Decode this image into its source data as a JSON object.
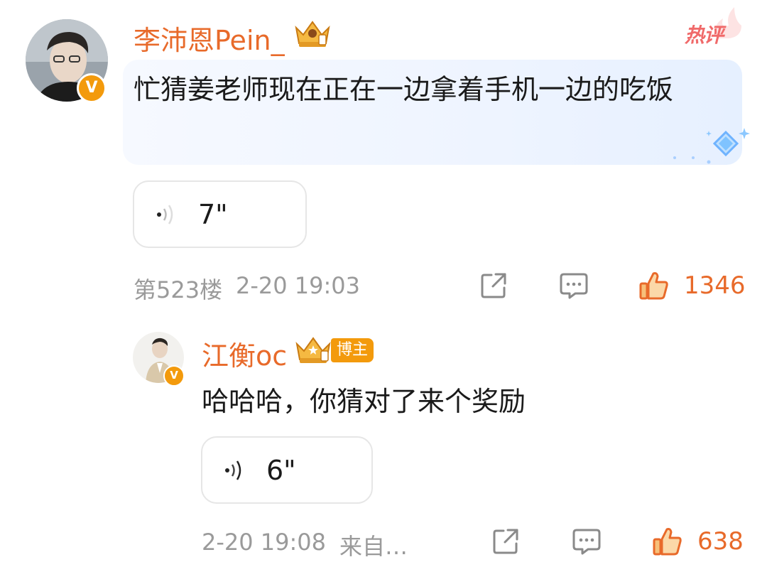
{
  "comment": {
    "username": "李沛恩Pein_",
    "hot_label": "热评",
    "text": "忙猜姜老师现在正在一边拿着手机一边的吃饭",
    "voice_duration": "7\"",
    "floor": "第523楼",
    "time": "2-20 19:03",
    "likes": "1346",
    "verified_badge": "V"
  },
  "reply": {
    "username": "江衡oc",
    "role_tag": "博主",
    "text": "哈哈哈，你猜对了来个奖励",
    "voice_duration": "6\"",
    "time": "2-20 19:08",
    "source": "来自…",
    "likes": "638",
    "verified_badge": "V"
  },
  "colors": {
    "accent": "#e86a2a",
    "meta_gray": "#9a9a9a",
    "badge_orange": "#f39a0c",
    "bubble_blue": "#eef4ff",
    "hot_red": "#f06a6a"
  },
  "icons": {
    "crown_level": "crown-badge-icon",
    "share": "share-icon",
    "comment": "comment-icon",
    "like": "thumbs-up-icon",
    "voice": "voice-wave-icon",
    "sparkle": "diamond-sparkle-icon"
  }
}
